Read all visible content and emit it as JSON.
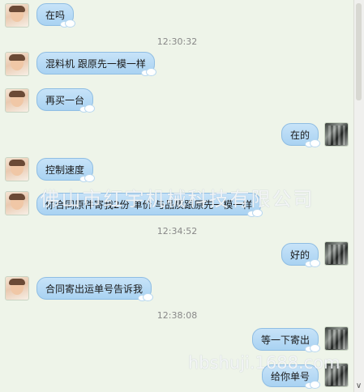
{
  "messages": [
    {
      "side": "left",
      "text": "在吗"
    },
    {
      "side": "left",
      "text": "混料机  跟原先一模一样"
    },
    {
      "side": "left",
      "text": "再买一台"
    },
    {
      "side": "right",
      "text": "在的"
    },
    {
      "side": "left",
      "text": "控制速度"
    },
    {
      "side": "left",
      "text": "你合同原件寄我2份 单价 与品质跟原先一模一样"
    },
    {
      "side": "right",
      "text": "好的"
    },
    {
      "side": "left",
      "text": "合同寄出运单号告诉我"
    },
    {
      "side": "right",
      "text": "等一下寄出"
    },
    {
      "side": "right",
      "text": "给你单号"
    }
  ],
  "timestamps": [
    "12:30:32",
    "12:34:52",
    "12:38:08"
  ],
  "watermark": {
    "line1": "佛山市红宇机械科技有限公司",
    "line2": "hbshuji.1688.com"
  },
  "colors": {
    "bubble": "#b8dcf5",
    "background": "#eef4e9"
  }
}
